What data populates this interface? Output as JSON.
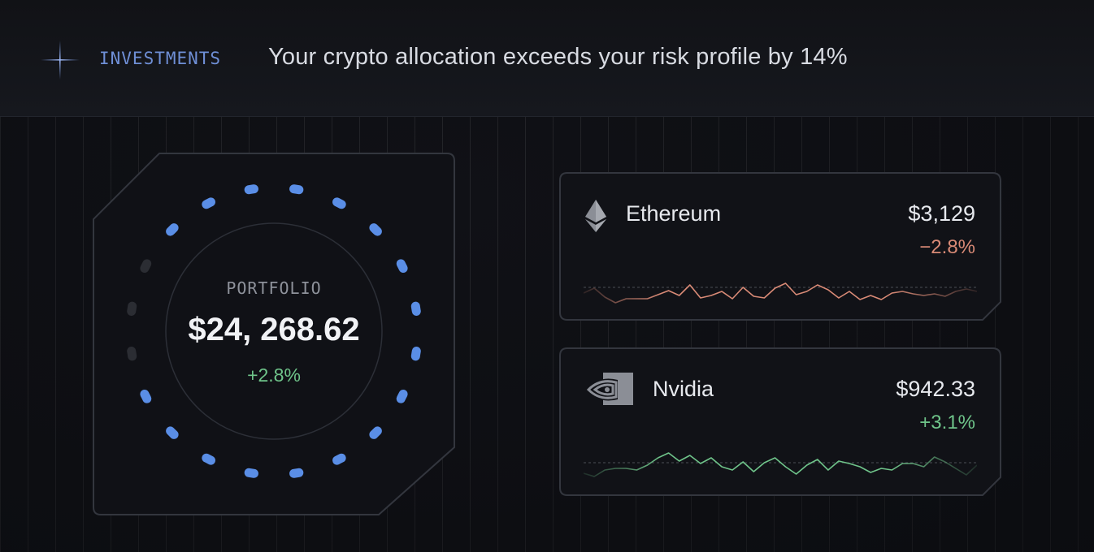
{
  "header": {
    "section_label": "INVESTMENTS",
    "alert": "Your crypto allocation exceeds your risk profile by 14%",
    "sparkle_icon": "sparkle-icon"
  },
  "portfolio": {
    "title": "PORTFOLIO",
    "value": "$24, 268.62",
    "change": "+2.8%",
    "allocation_fraction": 0.85,
    "ring_color": "#5a8ee6",
    "change_color": "#6fc48a"
  },
  "assets": [
    {
      "name": "Ethereum",
      "icon": "ethereum-icon",
      "price": "$3,129",
      "change": "−2.8%",
      "trend": "down",
      "color": "#d98a76",
      "sparkline": [
        50,
        44,
        55,
        62,
        57,
        57,
        57,
        52,
        47,
        53,
        40,
        56,
        53,
        48,
        57,
        43,
        54,
        56,
        44,
        38,
        52,
        48,
        40,
        46,
        56,
        48,
        58,
        53,
        58,
        50,
        48,
        51,
        53,
        51,
        54,
        48,
        45,
        48
      ]
    },
    {
      "name": "Nvidia",
      "icon": "nvidia-icon",
      "price": "$942.33",
      "change": "+3.1%",
      "trend": "up",
      "color": "#6fc48a",
      "sparkline": [
        56,
        60,
        52,
        50,
        50,
        52,
        46,
        37,
        31,
        41,
        34,
        44,
        37,
        48,
        52,
        42,
        54,
        43,
        37,
        48,
        57,
        46,
        39,
        52,
        41,
        44,
        48,
        55,
        50,
        52,
        44,
        44,
        48,
        36,
        42,
        50,
        58,
        46
      ]
    }
  ]
}
